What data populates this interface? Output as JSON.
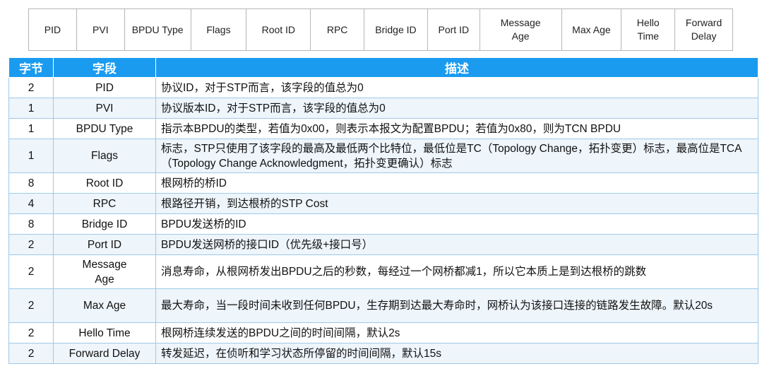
{
  "strip": {
    "fields": [
      "PID",
      "PVI",
      "BPDU Type",
      "Flags",
      "Root ID",
      "RPC",
      "Bridge ID",
      "Port ID",
      "Message\nAge",
      "Max Age",
      "Hello\nTime",
      "Forward\nDelay"
    ]
  },
  "table": {
    "headers": {
      "bytes": "字节",
      "field": "字段",
      "desc": "描述"
    },
    "rows": [
      {
        "bytes": "2",
        "field": "PID",
        "desc": "协议ID，对于STP而言，该字段的值总为0"
      },
      {
        "bytes": "1",
        "field": "PVI",
        "desc": "协议版本ID，对于STP而言，该字段的值总为0"
      },
      {
        "bytes": "1",
        "field": "BPDU Type",
        "desc": "指示本BPDU的类型，若值为0x00，则表示本报文为配置BPDU；若值为0x80，则为TCN BPDU"
      },
      {
        "bytes": "1",
        "field": "Flags",
        "desc": "标志，STP只使用了该字段的最高及最低两个比特位，最低位是TC（Topology Change，拓扑变更）标志，最高位是TCA（Topology Change Acknowledgment，拓扑变更确认）标志"
      },
      {
        "bytes": "8",
        "field": "Root ID",
        "desc": "根网桥的桥ID"
      },
      {
        "bytes": "4",
        "field": "RPC",
        "desc": "根路径开销，到达根桥的STP Cost"
      },
      {
        "bytes": "8",
        "field": "Bridge ID",
        "desc": "BPDU发送桥的ID"
      },
      {
        "bytes": "2",
        "field": "Port ID",
        "desc": "BPDU发送网桥的接口ID（优先级+接口号）"
      },
      {
        "bytes": "2",
        "field": "Message\nAge",
        "desc": "消息寿命，从根网桥发出BPDU之后的秒数，每经过一个网桥都减1，所以它本质上是到达根桥的跳数"
      },
      {
        "bytes": "2",
        "field": "Max Age",
        "desc": "最大寿命，当一段时间未收到任何BPDU，生存期到达最大寿命时，网桥认为该接口连接的链路发生故障。默认20s"
      },
      {
        "bytes": "2",
        "field": "Hello Time",
        "desc": "根网桥连续发送的BPDU之间的时间间隔，默认2s"
      },
      {
        "bytes": "2",
        "field": "Forward Delay",
        "desc": "转发延迟，在侦听和学习状态所停留的时间间隔，默认15s"
      }
    ]
  },
  "colors": {
    "header_bg": "#1a9bf0",
    "row_alt_bg": "#eef5fb",
    "border": "#9ec9e8"
  }
}
